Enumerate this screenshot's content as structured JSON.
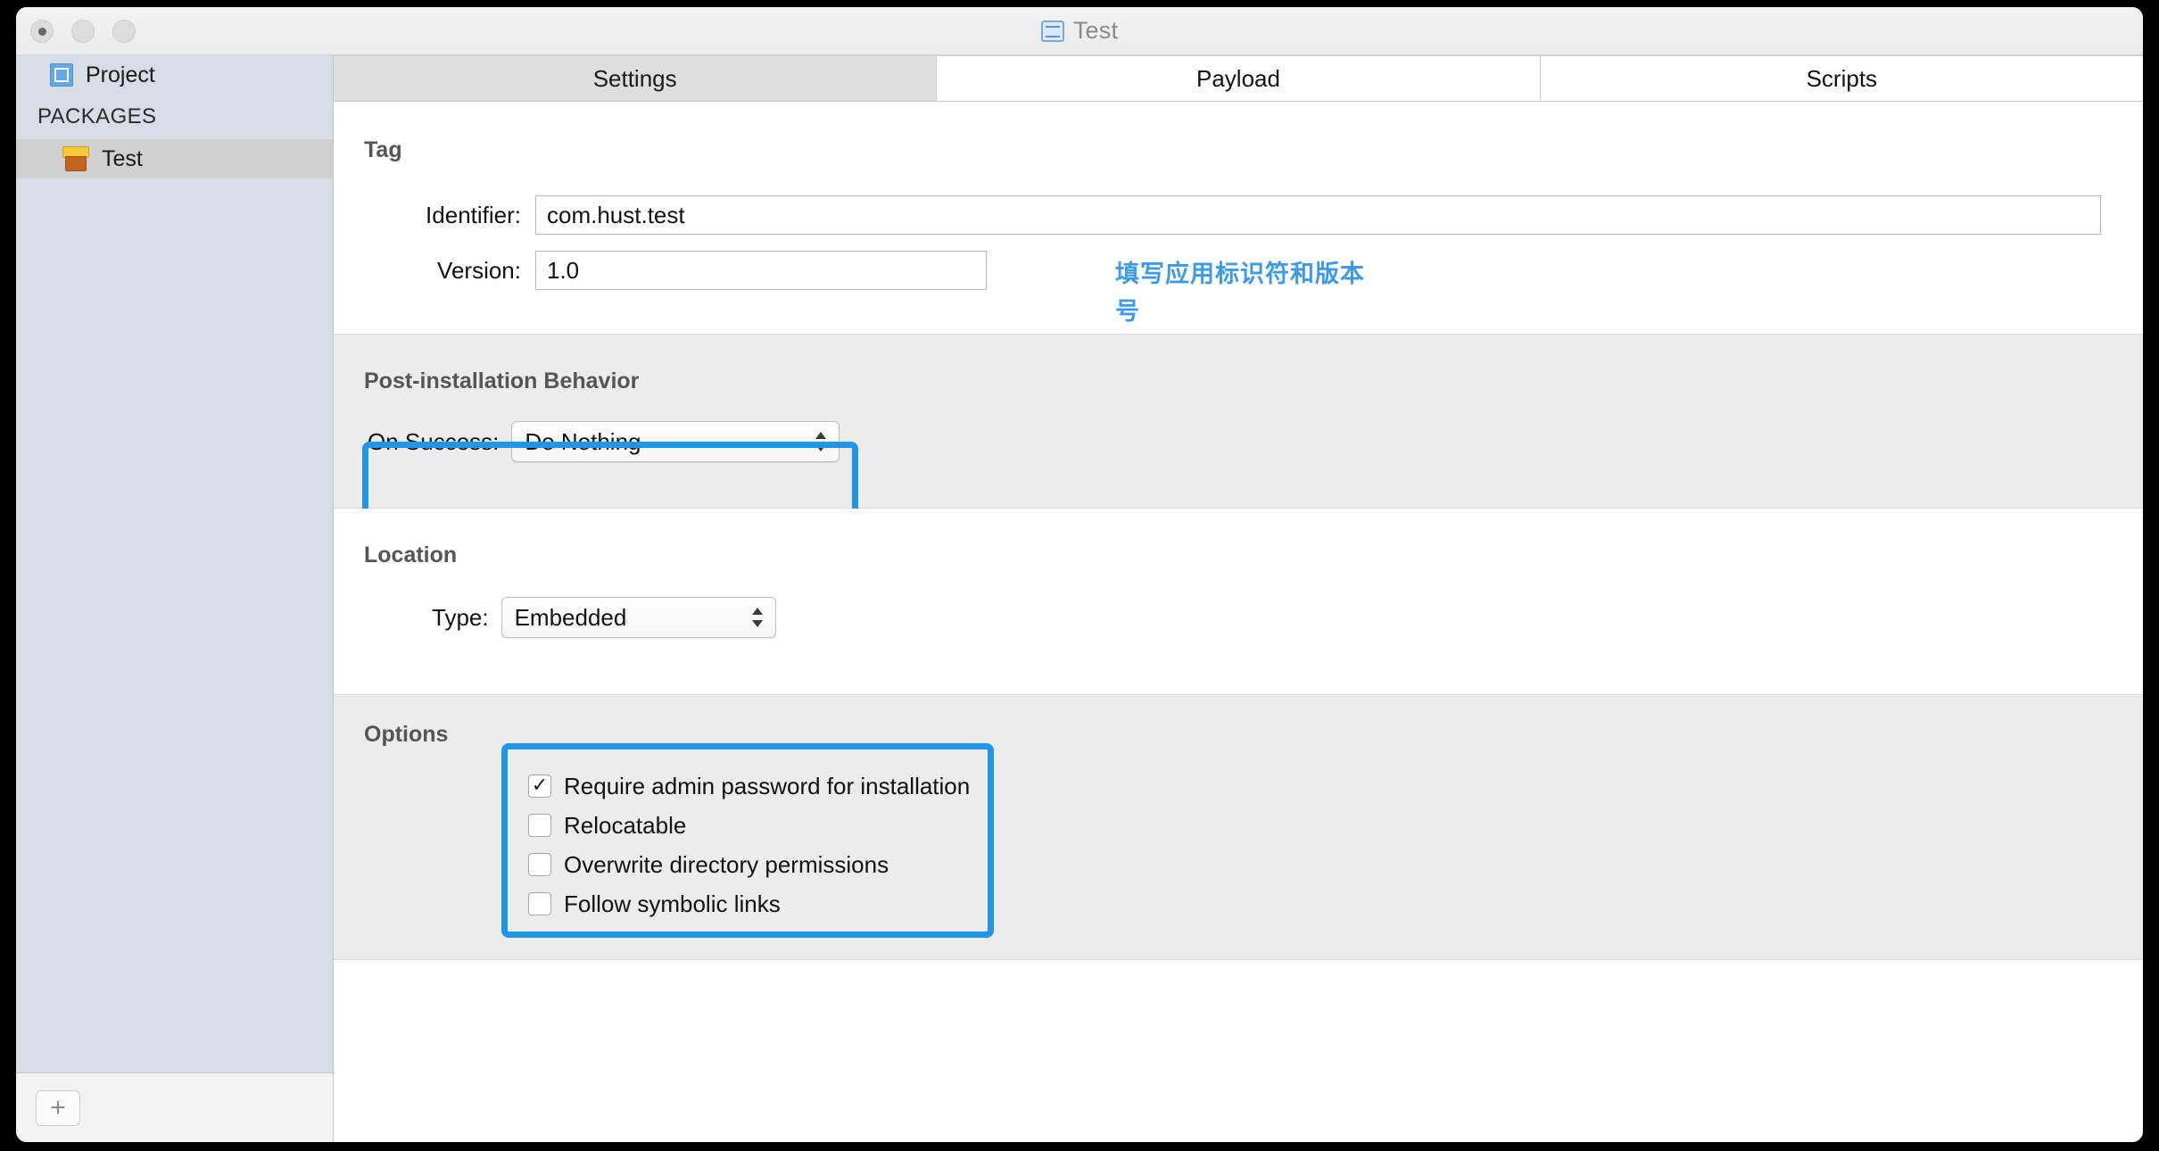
{
  "window": {
    "title": "Test",
    "title_icon": "project-document-icon",
    "traffic_lights": [
      "close",
      "minimize",
      "zoom"
    ]
  },
  "sidebar": {
    "project_row": {
      "label": "Project",
      "icon": "project-icon"
    },
    "group_label": "PACKAGES",
    "items": [
      {
        "label": "Test",
        "icon": "package-icon",
        "selected": true
      }
    ],
    "add_button_label": "+"
  },
  "tabs": [
    {
      "label": "Settings",
      "active": true
    },
    {
      "label": "Payload",
      "active": false
    },
    {
      "label": "Scripts",
      "active": false
    }
  ],
  "sections": {
    "tag": {
      "title": "Tag",
      "identifier_label": "Identifier:",
      "identifier_value": "com.hust.test",
      "version_label": "Version:",
      "version_value": "1.0"
    },
    "post_installation": {
      "title": "Post-installation Behavior",
      "on_success_label": "On Success:",
      "on_success_value": "Do Nothing"
    },
    "location": {
      "title": "Location",
      "type_label": "Type:",
      "type_value": "Embedded"
    },
    "options": {
      "title": "Options",
      "checkboxes": [
        {
          "label": "Require admin password for installation",
          "checked": true
        },
        {
          "label": "Relocatable",
          "checked": false
        },
        {
          "label": "Overwrite directory permissions",
          "checked": false
        },
        {
          "label": "Follow symbolic links",
          "checked": false
        }
      ]
    }
  },
  "annotation": {
    "text": "填写应用标识符和版本号",
    "color": "#3d9ae8"
  },
  "highlight_color": "#2196e8"
}
